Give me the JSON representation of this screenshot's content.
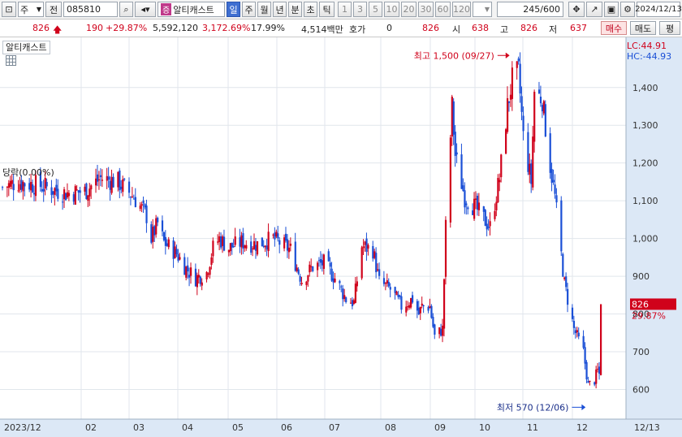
{
  "toolbar": {
    "period_combo": "주",
    "prefix_label": "전",
    "code": "085810",
    "stock_badge": "증",
    "stock_name": "알티캐스트",
    "intervals": [
      "일",
      "주",
      "월",
      "년",
      "분",
      "초",
      "틱"
    ],
    "selected_interval": "일",
    "tick_buttons": [
      "1",
      "3",
      "5",
      "10",
      "20",
      "30",
      "60",
      "120"
    ],
    "page_count": "245/600",
    "date": "2024/12/13"
  },
  "quote": {
    "price": "826",
    "change": "190",
    "change_pct": "+29.87%",
    "volume": "5,592,120",
    "volume_ratio": "3,172.69%",
    "turnover": "17.99%",
    "amount": "4,514백만",
    "hoga_label": "호가",
    "hoga_value": "0",
    "hoga_price": "826",
    "open_label": "시",
    "open": "638",
    "high_label": "고",
    "high": "826",
    "low_label": "저",
    "low": "637",
    "buy_label": "매수",
    "sell_label": "매도",
    "eval_label": "평"
  },
  "chart_legend": "알티캐스트",
  "chart_data": {
    "type": "candlestick",
    "ylim": [
      530,
      1520
    ],
    "y_ticks": [
      600,
      700,
      800,
      900,
      1000,
      1100,
      1200,
      1300,
      1400
    ],
    "y_tick_labels": [
      "600",
      "700",
      "800",
      "900",
      "1,000",
      "1,100",
      "1,200",
      "1,300",
      "1,400"
    ],
    "x_ticks": [
      "2023/12",
      "02",
      "03",
      "04",
      "05",
      "06",
      "07",
      "08",
      "09",
      "10",
      "11",
      "12",
      "12/13"
    ],
    "lc_label": "LC:44.91",
    "hc_label": "HC:-44.93",
    "current_price_label": "826",
    "current_change_label": "29.87%",
    "annotations": {
      "high_label": "최고 1,500 (09/27)",
      "low_label": "최저 570 (12/06)",
      "left_label": "당락(0.00%)"
    },
    "colors": {
      "up": "#d0021b",
      "down": "#1a4fd6"
    },
    "anchors": [
      {
        "d": "2023-12-01",
        "v": 1135
      },
      {
        "d": "2023-12-10",
        "v": 1150
      },
      {
        "d": "2023-12-25",
        "v": 1140
      },
      {
        "d": "2024-01-10",
        "v": 1120
      },
      {
        "d": "2024-01-22",
        "v": 1125
      },
      {
        "d": "2024-02-01",
        "v": 1160
      },
      {
        "d": "2024-02-12",
        "v": 1150
      },
      {
        "d": "2024-02-22",
        "v": 1110
      },
      {
        "d": "2024-03-01",
        "v": 1060
      },
      {
        "d": "2024-03-04",
        "v": 1000
      },
      {
        "d": "2024-03-08",
        "v": 1040
      },
      {
        "d": "2024-03-12",
        "v": 990
      },
      {
        "d": "2024-03-20",
        "v": 960
      },
      {
        "d": "2024-03-26",
        "v": 920
      },
      {
        "d": "2024-04-01",
        "v": 895
      },
      {
        "d": "2024-04-08",
        "v": 910
      },
      {
        "d": "2024-04-12",
        "v": 975
      },
      {
        "d": "2024-04-16",
        "v": 1000
      },
      {
        "d": "2024-04-22",
        "v": 975
      },
      {
        "d": "2024-04-30",
        "v": 990
      },
      {
        "d": "2024-05-10",
        "v": 985
      },
      {
        "d": "2024-05-20",
        "v": 1000
      },
      {
        "d": "2024-05-31",
        "v": 970
      },
      {
        "d": "2024-06-07",
        "v": 890
      },
      {
        "d": "2024-06-14",
        "v": 925
      },
      {
        "d": "2024-06-21",
        "v": 935
      },
      {
        "d": "2024-06-28",
        "v": 895
      },
      {
        "d": "2024-07-05",
        "v": 840
      },
      {
        "d": "2024-07-10",
        "v": 830
      },
      {
        "d": "2024-07-15",
        "v": 980
      },
      {
        "d": "2024-07-22",
        "v": 970
      },
      {
        "d": "2024-07-26",
        "v": 885
      },
      {
        "d": "2024-08-02",
        "v": 865
      },
      {
        "d": "2024-08-09",
        "v": 820
      },
      {
        "d": "2024-08-16",
        "v": 840
      },
      {
        "d": "2024-08-20",
        "v": 800
      },
      {
        "d": "2024-08-22",
        "v": 820
      },
      {
        "d": "2024-08-27",
        "v": 820
      },
      {
        "d": "2024-08-30",
        "v": 740
      },
      {
        "d": "2024-09-04",
        "v": 760
      },
      {
        "d": "2024-09-06",
        "v": 1030
      },
      {
        "d": "2024-09-10",
        "v": 1350
      },
      {
        "d": "2024-09-12",
        "v": 1220
      },
      {
        "d": "2024-09-18",
        "v": 1110
      },
      {
        "d": "2024-09-25",
        "v": 1080
      },
      {
        "d": "2024-10-04",
        "v": 1030
      },
      {
        "d": "2024-10-10",
        "v": 1160
      },
      {
        "d": "2024-10-15",
        "v": 1350
      },
      {
        "d": "2024-10-18",
        "v": 1420
      },
      {
        "d": "2024-10-22",
        "v": 1440
      },
      {
        "d": "2024-10-25",
        "v": 1270
      },
      {
        "d": "2024-10-30",
        "v": 1150
      },
      {
        "d": "2024-11-01",
        "v": 1390
      },
      {
        "d": "2024-11-06",
        "v": 1370
      },
      {
        "d": "2024-11-10",
        "v": 1220
      },
      {
        "d": "2024-11-14",
        "v": 1110
      },
      {
        "d": "2024-11-20",
        "v": 880
      },
      {
        "d": "2024-11-26",
        "v": 760
      },
      {
        "d": "2024-12-02",
        "v": 700
      },
      {
        "d": "2024-12-05",
        "v": 610
      },
      {
        "d": "2024-12-09",
        "v": 625
      },
      {
        "d": "2024-12-11",
        "v": 650
      },
      {
        "d": "2024-12-12",
        "v": 640
      },
      {
        "d": "2024-12-13",
        "v": 826
      }
    ],
    "x_start": "2023-12-01",
    "x_end": "2024-12-13"
  }
}
